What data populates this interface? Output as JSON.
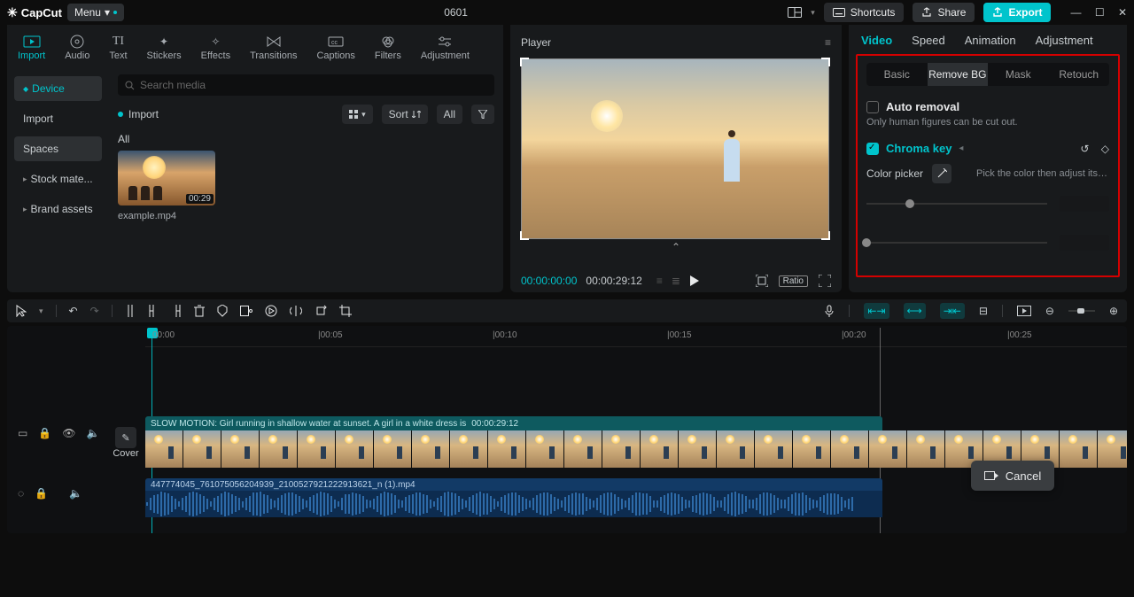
{
  "titlebar": {
    "logo": "CapCut",
    "menu_label": "Menu",
    "project_name": "0601",
    "shortcuts_label": "Shortcuts",
    "share_label": "Share",
    "export_label": "Export"
  },
  "top_tabs": {
    "import": "Import",
    "audio": "Audio",
    "text": "Text",
    "stickers": "Stickers",
    "effects": "Effects",
    "transitions": "Transitions",
    "captions": "Captions",
    "filters": "Filters",
    "adjustment": "Adjustment"
  },
  "media": {
    "nav": {
      "device": "Device",
      "import": "Import",
      "spaces": "Spaces",
      "stock": "Stock mate...",
      "brand": "Brand assets"
    },
    "search_placeholder": "Search media",
    "import_link": "Import",
    "sort_label": "Sort",
    "all_label": "All",
    "section_all": "All",
    "clip_name": "example.mp4",
    "clip_dur": "00:29"
  },
  "player": {
    "title": "Player",
    "time_current": "00:00:00:00",
    "time_total": "00:00:29:12",
    "ratio_badge": "Ratio"
  },
  "inspector": {
    "tabs": {
      "video": "Video",
      "speed": "Speed",
      "animation": "Animation",
      "adjustment": "Adjustment"
    },
    "subtabs": {
      "basic": "Basic",
      "removebg": "Remove BG",
      "mask": "Mask",
      "retouch": "Retouch"
    },
    "auto_removal": "Auto removal",
    "auto_removal_hint": "Only human figures can be cut out.",
    "chroma_key": "Chroma key",
    "color_picker": "Color picker",
    "picker_hint": "Pick the color then adjust its intensi..."
  },
  "timeline": {
    "ruler": [
      "00:00",
      "|00:05",
      "|00:10",
      "|00:15",
      "|00:20",
      "|00:25"
    ],
    "video_label": "SLOW MOTION: Girl running in shallow water at sunset. A girl in a white dress is",
    "video_tc": "00:00:29:12",
    "audio_name": "447774045_761075056204939_2100527921222913621_n (1).mp4",
    "cover_label": "Cover"
  },
  "toast": {
    "cancel": "Cancel"
  }
}
